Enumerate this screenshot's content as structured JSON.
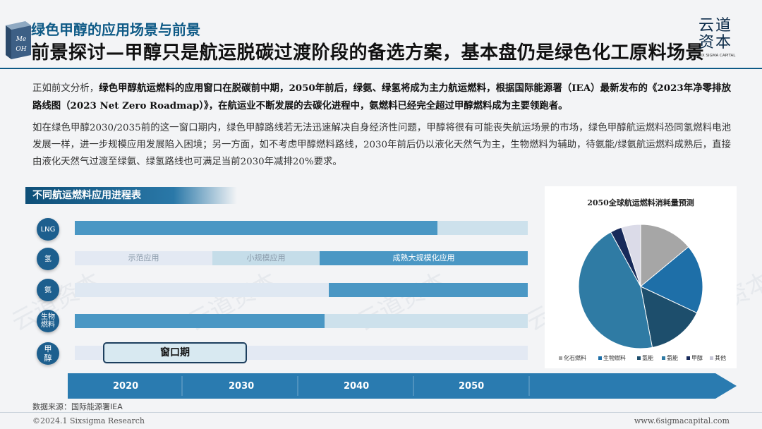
{
  "header": {
    "section_title": "绿色甲醇的应用场景与前景",
    "page_title": "前景探讨—甲醇只是航运脱碳过渡阶段的备选方案，基本盘仍是绿色化工原料场景",
    "logo_text_line1": "Me",
    "logo_text_line2": "OH",
    "brand_cn_line1": "云道",
    "brand_cn_line2": "资本",
    "brand_en": "SIX SIGMA CAPITAL"
  },
  "body": {
    "para1_a": "正如前文分析，",
    "para1_b": "绿色甲醇航运燃料的应用窗口在脱碳前中期，2050年前后，绿氨、绿氢将成为主力航运燃料，根据国际能源署（IEA）最新发布的《2023年净零排放路线图（2023 Net Zero Roadmap）》，在航运业不断发展的去碳化进程中，氨燃料已经完全超过甲醇燃料成为主要领跑者。",
    "para2": "如在绿色甲醇2030/2035前的这一窗口期内，绿色甲醇路线若无法迅速解决自身经济性问题，甲醇将很有可能丧失航运场景的市场，绿色甲醇航运燃料恐同氢燃料电池发展一样，进一步规模应用发展陷入困境；另一方面，如不考虑甲醇燃料路线，2030年前后仍以液化天然气为主，生物燃料为辅助，待氨能/绿氨航运燃料成熟后，直接由液化天然气过渡至绿氨、绿氢路线也可满足当前2030年减排20%要求。"
  },
  "timeline": {
    "title": "不同航运燃料应用进程表",
    "rows": [
      {
        "label": "LNG",
        "fill_start": 0.0,
        "fill_end": 0.8
      },
      {
        "label": "氢",
        "fill_start": 0.541,
        "fill_end": 1.0
      },
      {
        "label": "氨",
        "fill_start": 0.561,
        "fill_end": 1.0
      },
      {
        "label": "生物燃料",
        "fill_start": 0.0,
        "fill_end": 0.552
      },
      {
        "label": "甲醇",
        "fill_start": 0.0,
        "fill_end": 0.0
      }
    ],
    "stages": [
      "示范应用",
      "小规模应用",
      "成熟大规模化应用"
    ],
    "window_label": "窗口期",
    "years": [
      "2020",
      "2030",
      "2040",
      "2050"
    ],
    "source": "数据来源：国际能源署IEA"
  },
  "pie": {
    "title": "2050全球航运燃料消耗量预测",
    "legend": [
      "化石燃料",
      "生物燃料",
      "氢能",
      "氨能",
      "甲醇",
      "其他"
    ],
    "colors": [
      "#a6a6a6",
      "#1e6fa8",
      "#1d4e6c",
      "#2f7ba4",
      "#172a5a",
      "#dbdbe8"
    ]
  },
  "chart_data": {
    "type": "pie",
    "title": "2050全球航运燃料消耗量预测",
    "categories": [
      "化石燃料",
      "生物燃料",
      "氢能",
      "氨能",
      "甲醇",
      "其他"
    ],
    "values": [
      14,
      18,
      15,
      45,
      3,
      5
    ]
  },
  "footer": {
    "copyright": "©2024.1 Sixsigma Research",
    "website": "www.6sigmacapital.com"
  }
}
